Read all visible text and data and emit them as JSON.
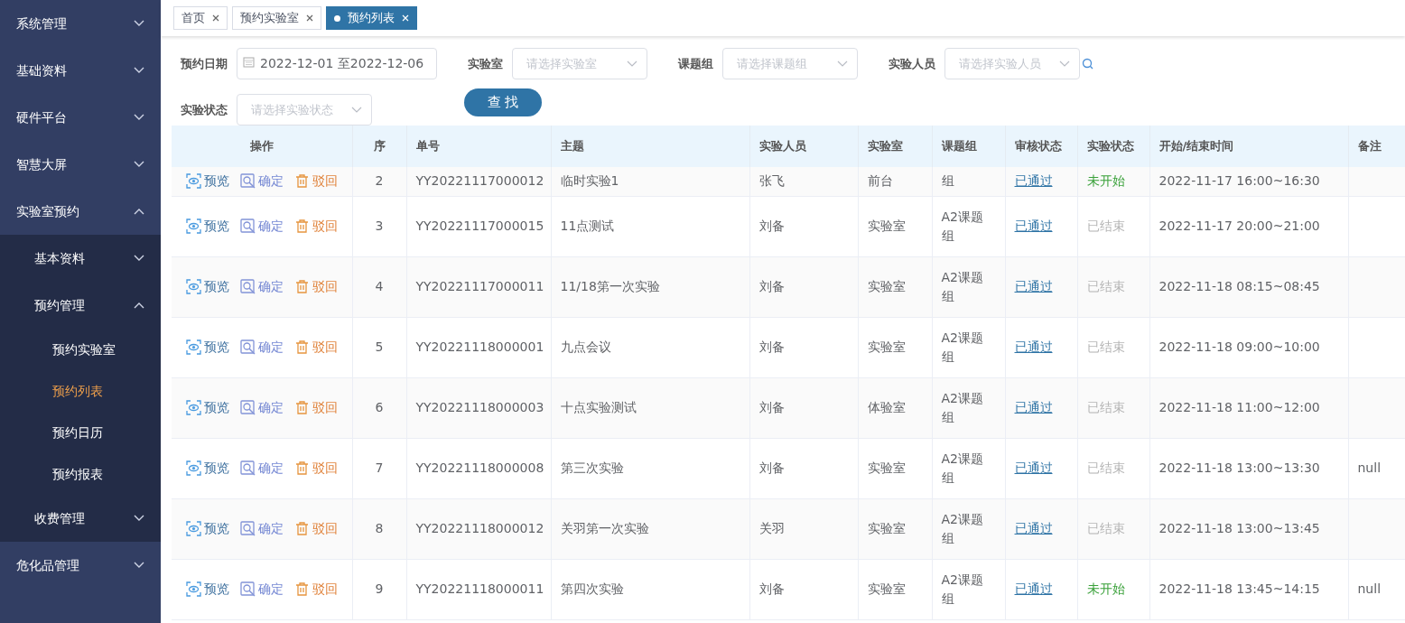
{
  "sidebar": {
    "items": [
      {
        "label": "系统管理",
        "expanded": false,
        "selected": false
      },
      {
        "label": "基础资料",
        "expanded": false,
        "selected": false
      },
      {
        "label": "硬件平台",
        "expanded": false,
        "selected": false
      },
      {
        "label": "智慧大屏",
        "expanded": false,
        "selected": false
      },
      {
        "label": "实验室预约",
        "expanded": true,
        "selected": false,
        "children": [
          {
            "label": "基本资料",
            "expanded": false,
            "selected": false
          },
          {
            "label": "预约管理",
            "expanded": true,
            "selected": false,
            "children": [
              {
                "label": "预约实验室",
                "selected": false
              },
              {
                "label": "预约列表",
                "selected": true
              },
              {
                "label": "预约日历",
                "selected": false
              },
              {
                "label": "预约报表",
                "selected": false
              }
            ]
          },
          {
            "label": "收费管理",
            "expanded": false,
            "selected": false
          }
        ]
      },
      {
        "label": "危化品管理",
        "expanded": false,
        "selected": false
      }
    ]
  },
  "tabs": [
    {
      "label": "首页",
      "selected": false
    },
    {
      "label": "预约实验室",
      "selected": false
    },
    {
      "label": "预约列表",
      "selected": true
    }
  ],
  "filters": [
    {
      "kind": "date",
      "label": "预约日期",
      "value": "2022-12-01 至2022-12-06"
    },
    {
      "kind": "select",
      "label": "实验室",
      "placeholder": "请选择实验室"
    },
    {
      "kind": "select",
      "label": "课题组",
      "placeholder": "请选择课题组"
    },
    {
      "kind": "select",
      "label": "实验人员",
      "placeholder": "请选择实验人员",
      "search": true
    },
    {
      "kind": "select",
      "label": "实验状态",
      "placeholder": "请选择实验状态"
    }
  ],
  "search_button": "查 找",
  "table": {
    "columns": [
      "操作",
      "序",
      "单号",
      "主题",
      "实验人员",
      "实验室",
      "课题组",
      "审核状态",
      "实验状态",
      "开始/结束时间",
      "备注"
    ],
    "rows": [
      {
        "partial": true,
        "actions": [
          {
            "kind": "preview",
            "label": "预览"
          },
          {
            "kind": "confirm",
            "label": "确定"
          },
          {
            "kind": "reject",
            "label": "驳回"
          }
        ],
        "index": "2",
        "number": "YY20221117000012",
        "subject": "临时实验1",
        "person": "张飞",
        "lab": "前台",
        "group": "组",
        "review": "已通过",
        "status": {
          "kind": "pending",
          "text": "未开始"
        },
        "time": "2022-11-17 16:00~16:30",
        "remark": ""
      },
      {
        "partial": false,
        "actions": [
          {
            "kind": "preview",
            "label": "预览"
          },
          {
            "kind": "confirm",
            "label": "确定"
          },
          {
            "kind": "reject",
            "label": "驳回"
          }
        ],
        "index": "3",
        "number": "YY20221117000015",
        "subject": "11点测试",
        "person": "刘备",
        "lab": "实验室",
        "group": "A2课题组",
        "review": "已通过",
        "status": {
          "kind": "done",
          "text": "已结束"
        },
        "time": "2022-11-17 20:00~21:00",
        "remark": ""
      },
      {
        "partial": false,
        "actions": [
          {
            "kind": "preview",
            "label": "预览"
          },
          {
            "kind": "confirm",
            "label": "确定"
          },
          {
            "kind": "reject",
            "label": "驳回"
          }
        ],
        "index": "4",
        "number": "YY20221117000011",
        "subject": "11/18第一次实验",
        "person": "刘备",
        "lab": "实验室",
        "group": "A2课题组",
        "review": "已通过",
        "status": {
          "kind": "done",
          "text": "已结束"
        },
        "time": "2022-11-18 08:15~08:45",
        "remark": ""
      },
      {
        "partial": false,
        "actions": [
          {
            "kind": "preview",
            "label": "预览"
          },
          {
            "kind": "confirm",
            "label": "确定"
          },
          {
            "kind": "reject",
            "label": "驳回"
          }
        ],
        "index": "5",
        "number": "YY20221118000001",
        "subject": "九点会议",
        "person": "刘备",
        "lab": "实验室",
        "group": "A2课题组",
        "review": "已通过",
        "status": {
          "kind": "done",
          "text": "已结束"
        },
        "time": "2022-11-18 09:00~10:00",
        "remark": ""
      },
      {
        "partial": false,
        "actions": [
          {
            "kind": "preview",
            "label": "预览"
          },
          {
            "kind": "confirm",
            "label": "确定"
          },
          {
            "kind": "reject",
            "label": "驳回"
          }
        ],
        "index": "6",
        "number": "YY20221118000003",
        "subject": "十点实验测试",
        "person": "刘备",
        "lab": "体验室",
        "group": "A2课题组",
        "review": "已通过",
        "status": {
          "kind": "done",
          "text": "已结束"
        },
        "time": "2022-11-18 11:00~12:00",
        "remark": ""
      },
      {
        "partial": false,
        "actions": [
          {
            "kind": "preview",
            "label": "预览"
          },
          {
            "kind": "confirm",
            "label": "确定"
          },
          {
            "kind": "reject",
            "label": "驳回"
          }
        ],
        "index": "7",
        "number": "YY20221118000008",
        "subject": "第三次实验",
        "person": "刘备",
        "lab": "实验室",
        "group": "A2课题组",
        "review": "已通过",
        "status": {
          "kind": "done",
          "text": "已结束"
        },
        "time": "2022-11-18 13:00~13:30",
        "remark": "null"
      },
      {
        "partial": false,
        "actions": [
          {
            "kind": "preview",
            "label": "预览"
          },
          {
            "kind": "confirm",
            "label": "确定"
          },
          {
            "kind": "reject",
            "label": "驳回"
          }
        ],
        "index": "8",
        "number": "YY20221118000012",
        "subject": "关羽第一次实验",
        "person": "关羽",
        "lab": "实验室",
        "group": "A2课题组",
        "review": "已通过",
        "status": {
          "kind": "done",
          "text": "已结束"
        },
        "time": "2022-11-18 13:00~13:45",
        "remark": ""
      },
      {
        "partial": false,
        "actions": [
          {
            "kind": "preview",
            "label": "预览"
          },
          {
            "kind": "confirm",
            "label": "确定"
          },
          {
            "kind": "reject",
            "label": "驳回"
          }
        ],
        "index": "9",
        "number": "YY20221118000011",
        "subject": "第四次实验",
        "person": "刘备",
        "lab": "实验室",
        "group": "A2课题组",
        "review": "已通过",
        "status": {
          "kind": "pending",
          "text": "未开始"
        },
        "time": "2022-11-18 13:45~14:15",
        "remark": "null"
      }
    ]
  }
}
